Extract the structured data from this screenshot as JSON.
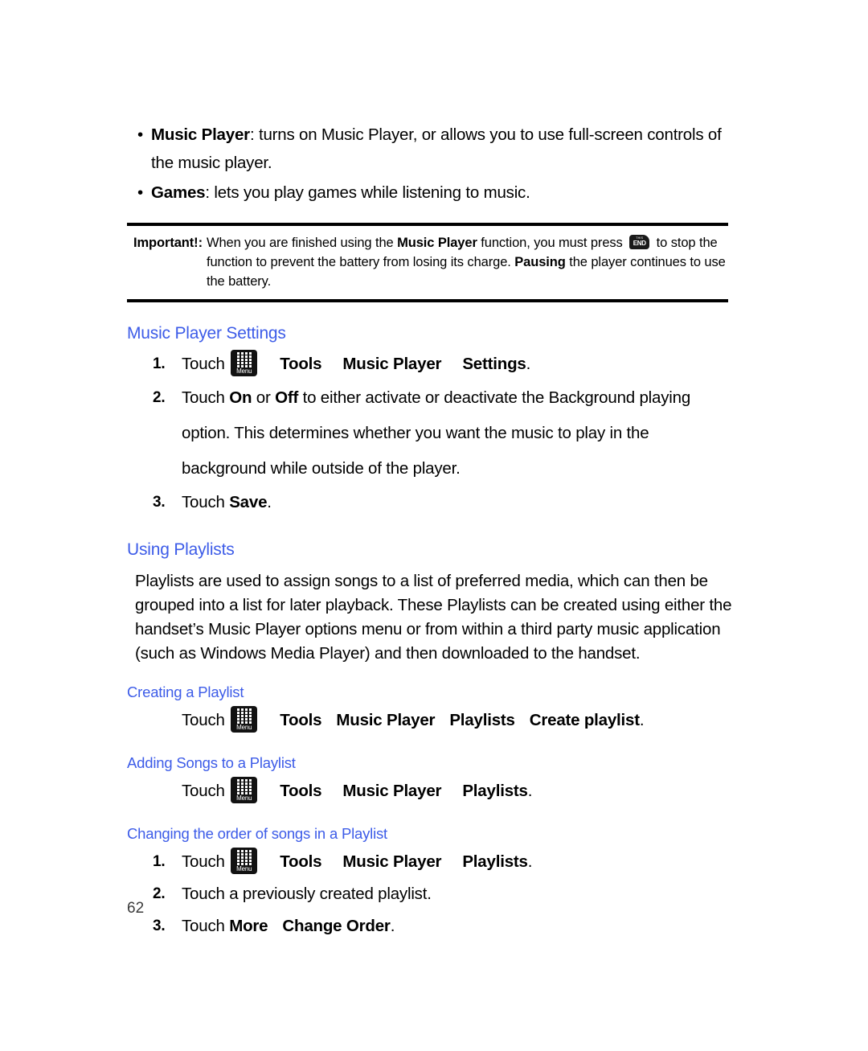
{
  "document": {
    "page_number": "62",
    "accent_color": "#3d5ce8",
    "text_color": "#000000"
  },
  "bullets": [
    {
      "marker": "•",
      "term": "Music Player",
      "rest": ": turns on Music Player, or allows you to use full-screen controls of the music player."
    },
    {
      "marker": "•",
      "term": "Games",
      "rest": ": lets you play games while listening to music."
    }
  ],
  "important_note": {
    "label": "Important!:",
    "part1": "When you are finished using the ",
    "bold1": "Music Player",
    "part2": " function, you must press ",
    "key_icon": {
      "name": "end-key-icon",
      "top_text": "THIS",
      "label": "END"
    },
    "part3": " to stop the function to prevent the battery from losing its charge. ",
    "bold2": "Pausing",
    "part4": " the player continues to use the battery."
  },
  "sections": {
    "music_player_settings": {
      "heading": "Music Player Settings",
      "steps": [
        {
          "num": "1.",
          "touch": "Touch",
          "icon": "menu-softkey-icon",
          "icon_label": "Menu",
          "path": [
            "Tools",
            "Music Player",
            "Settings"
          ],
          "period": "."
        },
        {
          "num": "2.",
          "text_lines": [
            "Touch On or Off to either activate or deactivate the Background playing",
            "option. This determines whether you want the music to play in the",
            "background while outside of the player."
          ],
          "pre": "Touch ",
          "bold_a": "On",
          "mid": " or ",
          "bold_b": "Off",
          "post": " to either activate or deactivate the Background playing option. This determines whether you want the music to play in the background while outside of the player."
        },
        {
          "num": "3.",
          "pre": "Touch ",
          "bold_a": "Save",
          "post": "."
        }
      ]
    },
    "using_playlists": {
      "heading": "Using Playlists",
      "paragraph": "Playlists are used to assign songs to a list of preferred media, which can then be grouped into a list for later playback. These Playlists can be created using either the handset’s Music Player options menu or from within a third party music application (such as Windows Media Player) and then downloaded to the handset.",
      "subsections": [
        {
          "heading": "Creating a Playlist",
          "step": {
            "num": "",
            "touch": "Touch",
            "icon_label": "Menu",
            "path": [
              "Tools",
              "Music Player",
              "Playlists",
              "Create playlist"
            ],
            "period": "."
          }
        },
        {
          "heading": "Adding Songs to a Playlist",
          "step": {
            "num": "",
            "touch": "Touch",
            "icon_label": "Menu",
            "path": [
              "Tools",
              "Music Player",
              "Playlists"
            ],
            "period": "."
          }
        },
        {
          "heading": "Changing the order of songs in a Playlist",
          "steps": [
            {
              "num": "1.",
              "touch": "Touch",
              "icon_label": "Menu",
              "path": [
                "Tools",
                "Music Player",
                "Playlists"
              ],
              "period": "."
            },
            {
              "num": "2.",
              "text": "Touch a previously created playlist."
            },
            {
              "num": "3.",
              "pre": "Touch ",
              "bold_a": "More",
              "bold_b": "Change Order",
              "post": "."
            }
          ]
        }
      ]
    }
  }
}
